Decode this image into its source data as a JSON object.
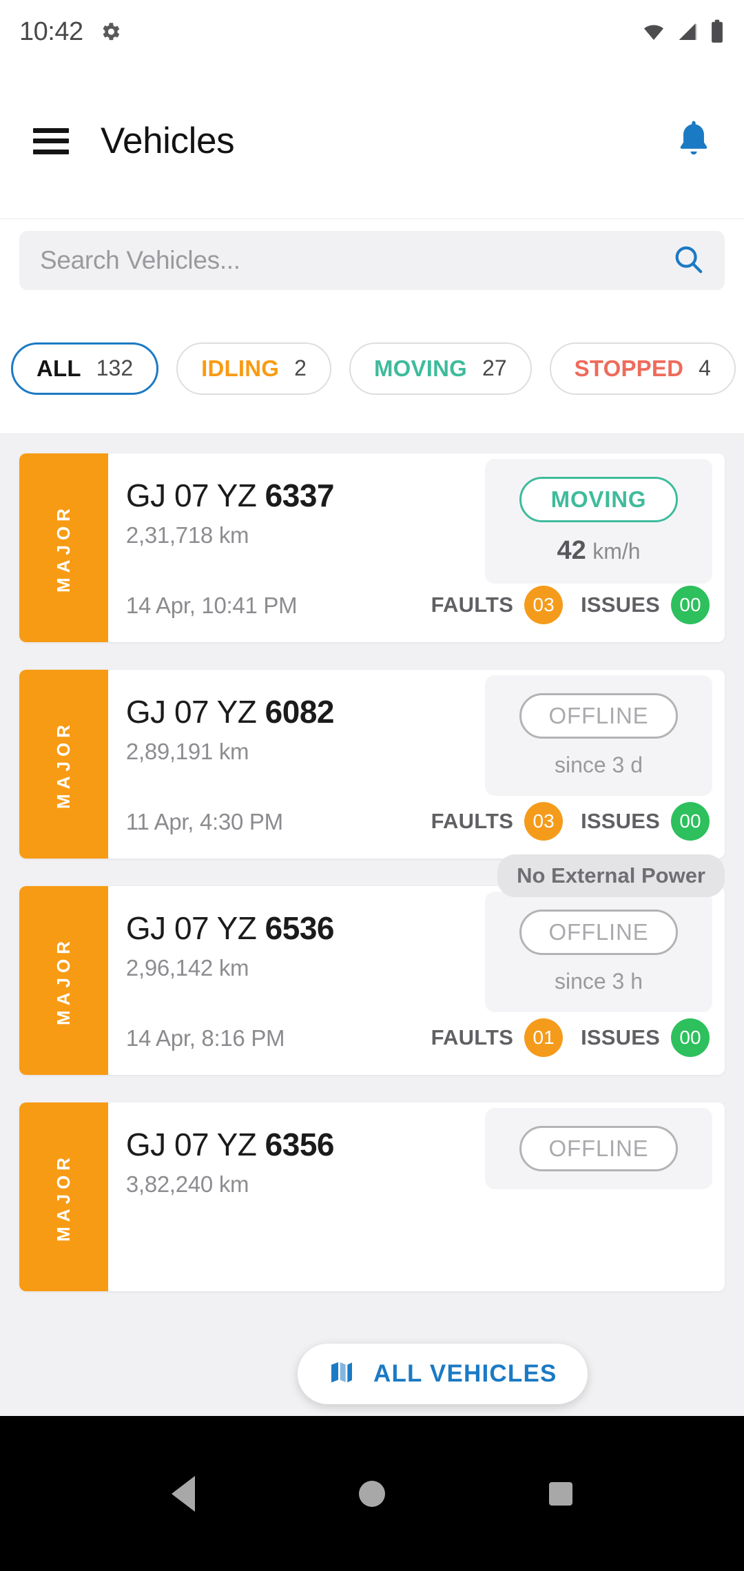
{
  "status_bar": {
    "time": "10:42",
    "gear_icon": "gear-icon",
    "wifi_icon": "wifi-icon",
    "signal_icon": "cellular-signal-icon",
    "battery_icon": "battery-icon"
  },
  "app_bar": {
    "menu_icon": "hamburger-menu-icon",
    "title": "Vehicles",
    "notification_icon": "bell-icon",
    "notification_color": "#1b7ac4"
  },
  "search": {
    "placeholder": "Search Vehicles...",
    "icon": "search-icon",
    "icon_color": "#1b7ac4"
  },
  "filters": [
    {
      "label": "ALL",
      "count": "132",
      "color": "#141414",
      "selected": true
    },
    {
      "label": "IDLING",
      "count": "2",
      "color": "#f89b14",
      "selected": false
    },
    {
      "label": "MOVING",
      "count": "27",
      "color": "#3fbb9c",
      "selected": false
    },
    {
      "label": "STOPPED",
      "count": "4",
      "color": "#ee6b5b",
      "selected": false
    }
  ],
  "vehicles": [
    {
      "severity": "MAJOR",
      "severity_color": "#f89b14",
      "plate_prefix": "GJ 07 YZ ",
      "plate_number": "6337",
      "odometer": "2,31,718 km",
      "timestamp": "14 Apr, 10:41 PM",
      "status": "MOVING",
      "status_color": "#3fbb9c",
      "status_sub_value": "42",
      "status_sub_unit": "km/h",
      "faults_label": "FAULTS",
      "faults_count": "03",
      "issues_label": "ISSUES",
      "issues_count": "00",
      "tag": ""
    },
    {
      "severity": "MAJOR",
      "severity_color": "#f89b14",
      "plate_prefix": "GJ 07 YZ ",
      "plate_number": "6082",
      "odometer": "2,89,191 km",
      "timestamp": "11 Apr, 4:30 PM",
      "status": "OFFLINE",
      "status_color": "#aaaaae",
      "status_sub_value": "",
      "status_sub_unit": "since 3 d",
      "faults_label": "FAULTS",
      "faults_count": "03",
      "issues_label": "ISSUES",
      "issues_count": "00",
      "tag": ""
    },
    {
      "severity": "MAJOR",
      "severity_color": "#f89b14",
      "plate_prefix": "GJ 07 YZ ",
      "plate_number": "6536",
      "odometer": "2,96,142 km",
      "timestamp": "14 Apr, 8:16 PM",
      "status": "OFFLINE",
      "status_color": "#aaaaae",
      "status_sub_value": "",
      "status_sub_unit": "since 3 h",
      "faults_label": "FAULTS",
      "faults_count": "01",
      "issues_label": "ISSUES",
      "issues_count": "00",
      "tag": "No External Power"
    },
    {
      "severity": "MAJOR",
      "severity_color": "#f89b14",
      "plate_prefix": "GJ 07 YZ ",
      "plate_number": "6356",
      "odometer": "3,82,240 km",
      "timestamp": "",
      "status": "OFFLINE",
      "status_color": "#aaaaae",
      "status_sub_value": "",
      "status_sub_unit": "",
      "faults_label": "",
      "faults_count": "",
      "issues_label": "",
      "issues_count": "",
      "tag": ""
    }
  ],
  "fab": {
    "label": "ALL VEHICLES",
    "icon": "map-icon",
    "color": "#1b7ac4"
  },
  "nav_bar": {
    "back_icon": "back-triangle-icon",
    "home_icon": "home-circle-icon",
    "recents_icon": "recents-square-icon"
  }
}
